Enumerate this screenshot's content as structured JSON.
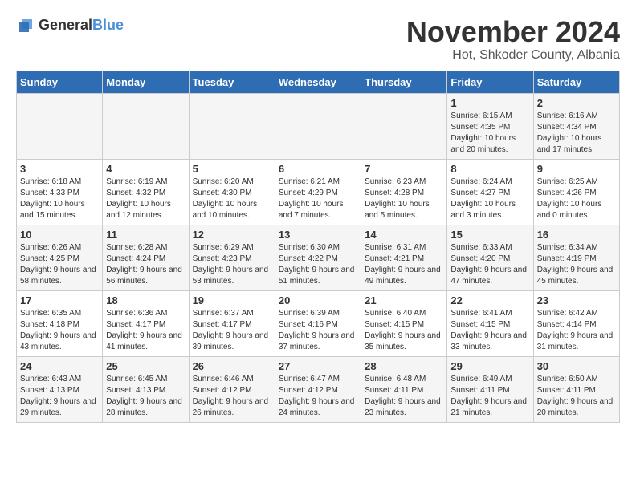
{
  "logo": {
    "general": "General",
    "blue": "Blue"
  },
  "title": {
    "month": "November 2024",
    "location": "Hot, Shkoder County, Albania"
  },
  "weekdays": [
    "Sunday",
    "Monday",
    "Tuesday",
    "Wednesday",
    "Thursday",
    "Friday",
    "Saturday"
  ],
  "weeks": [
    [
      {
        "day": "",
        "info": ""
      },
      {
        "day": "",
        "info": ""
      },
      {
        "day": "",
        "info": ""
      },
      {
        "day": "",
        "info": ""
      },
      {
        "day": "",
        "info": ""
      },
      {
        "day": "1",
        "info": "Sunrise: 6:15 AM\nSunset: 4:35 PM\nDaylight: 10 hours and 20 minutes."
      },
      {
        "day": "2",
        "info": "Sunrise: 6:16 AM\nSunset: 4:34 PM\nDaylight: 10 hours and 17 minutes."
      }
    ],
    [
      {
        "day": "3",
        "info": "Sunrise: 6:18 AM\nSunset: 4:33 PM\nDaylight: 10 hours and 15 minutes."
      },
      {
        "day": "4",
        "info": "Sunrise: 6:19 AM\nSunset: 4:32 PM\nDaylight: 10 hours and 12 minutes."
      },
      {
        "day": "5",
        "info": "Sunrise: 6:20 AM\nSunset: 4:30 PM\nDaylight: 10 hours and 10 minutes."
      },
      {
        "day": "6",
        "info": "Sunrise: 6:21 AM\nSunset: 4:29 PM\nDaylight: 10 hours and 7 minutes."
      },
      {
        "day": "7",
        "info": "Sunrise: 6:23 AM\nSunset: 4:28 PM\nDaylight: 10 hours and 5 minutes."
      },
      {
        "day": "8",
        "info": "Sunrise: 6:24 AM\nSunset: 4:27 PM\nDaylight: 10 hours and 3 minutes."
      },
      {
        "day": "9",
        "info": "Sunrise: 6:25 AM\nSunset: 4:26 PM\nDaylight: 10 hours and 0 minutes."
      }
    ],
    [
      {
        "day": "10",
        "info": "Sunrise: 6:26 AM\nSunset: 4:25 PM\nDaylight: 9 hours and 58 minutes."
      },
      {
        "day": "11",
        "info": "Sunrise: 6:28 AM\nSunset: 4:24 PM\nDaylight: 9 hours and 56 minutes."
      },
      {
        "day": "12",
        "info": "Sunrise: 6:29 AM\nSunset: 4:23 PM\nDaylight: 9 hours and 53 minutes."
      },
      {
        "day": "13",
        "info": "Sunrise: 6:30 AM\nSunset: 4:22 PM\nDaylight: 9 hours and 51 minutes."
      },
      {
        "day": "14",
        "info": "Sunrise: 6:31 AM\nSunset: 4:21 PM\nDaylight: 9 hours and 49 minutes."
      },
      {
        "day": "15",
        "info": "Sunrise: 6:33 AM\nSunset: 4:20 PM\nDaylight: 9 hours and 47 minutes."
      },
      {
        "day": "16",
        "info": "Sunrise: 6:34 AM\nSunset: 4:19 PM\nDaylight: 9 hours and 45 minutes."
      }
    ],
    [
      {
        "day": "17",
        "info": "Sunrise: 6:35 AM\nSunset: 4:18 PM\nDaylight: 9 hours and 43 minutes."
      },
      {
        "day": "18",
        "info": "Sunrise: 6:36 AM\nSunset: 4:17 PM\nDaylight: 9 hours and 41 minutes."
      },
      {
        "day": "19",
        "info": "Sunrise: 6:37 AM\nSunset: 4:17 PM\nDaylight: 9 hours and 39 minutes."
      },
      {
        "day": "20",
        "info": "Sunrise: 6:39 AM\nSunset: 4:16 PM\nDaylight: 9 hours and 37 minutes."
      },
      {
        "day": "21",
        "info": "Sunrise: 6:40 AM\nSunset: 4:15 PM\nDaylight: 9 hours and 35 minutes."
      },
      {
        "day": "22",
        "info": "Sunrise: 6:41 AM\nSunset: 4:15 PM\nDaylight: 9 hours and 33 minutes."
      },
      {
        "day": "23",
        "info": "Sunrise: 6:42 AM\nSunset: 4:14 PM\nDaylight: 9 hours and 31 minutes."
      }
    ],
    [
      {
        "day": "24",
        "info": "Sunrise: 6:43 AM\nSunset: 4:13 PM\nDaylight: 9 hours and 29 minutes."
      },
      {
        "day": "25",
        "info": "Sunrise: 6:45 AM\nSunset: 4:13 PM\nDaylight: 9 hours and 28 minutes."
      },
      {
        "day": "26",
        "info": "Sunrise: 6:46 AM\nSunset: 4:12 PM\nDaylight: 9 hours and 26 minutes."
      },
      {
        "day": "27",
        "info": "Sunrise: 6:47 AM\nSunset: 4:12 PM\nDaylight: 9 hours and 24 minutes."
      },
      {
        "day": "28",
        "info": "Sunrise: 6:48 AM\nSunset: 4:11 PM\nDaylight: 9 hours and 23 minutes."
      },
      {
        "day": "29",
        "info": "Sunrise: 6:49 AM\nSunset: 4:11 PM\nDaylight: 9 hours and 21 minutes."
      },
      {
        "day": "30",
        "info": "Sunrise: 6:50 AM\nSunset: 4:11 PM\nDaylight: 9 hours and 20 minutes."
      }
    ]
  ]
}
